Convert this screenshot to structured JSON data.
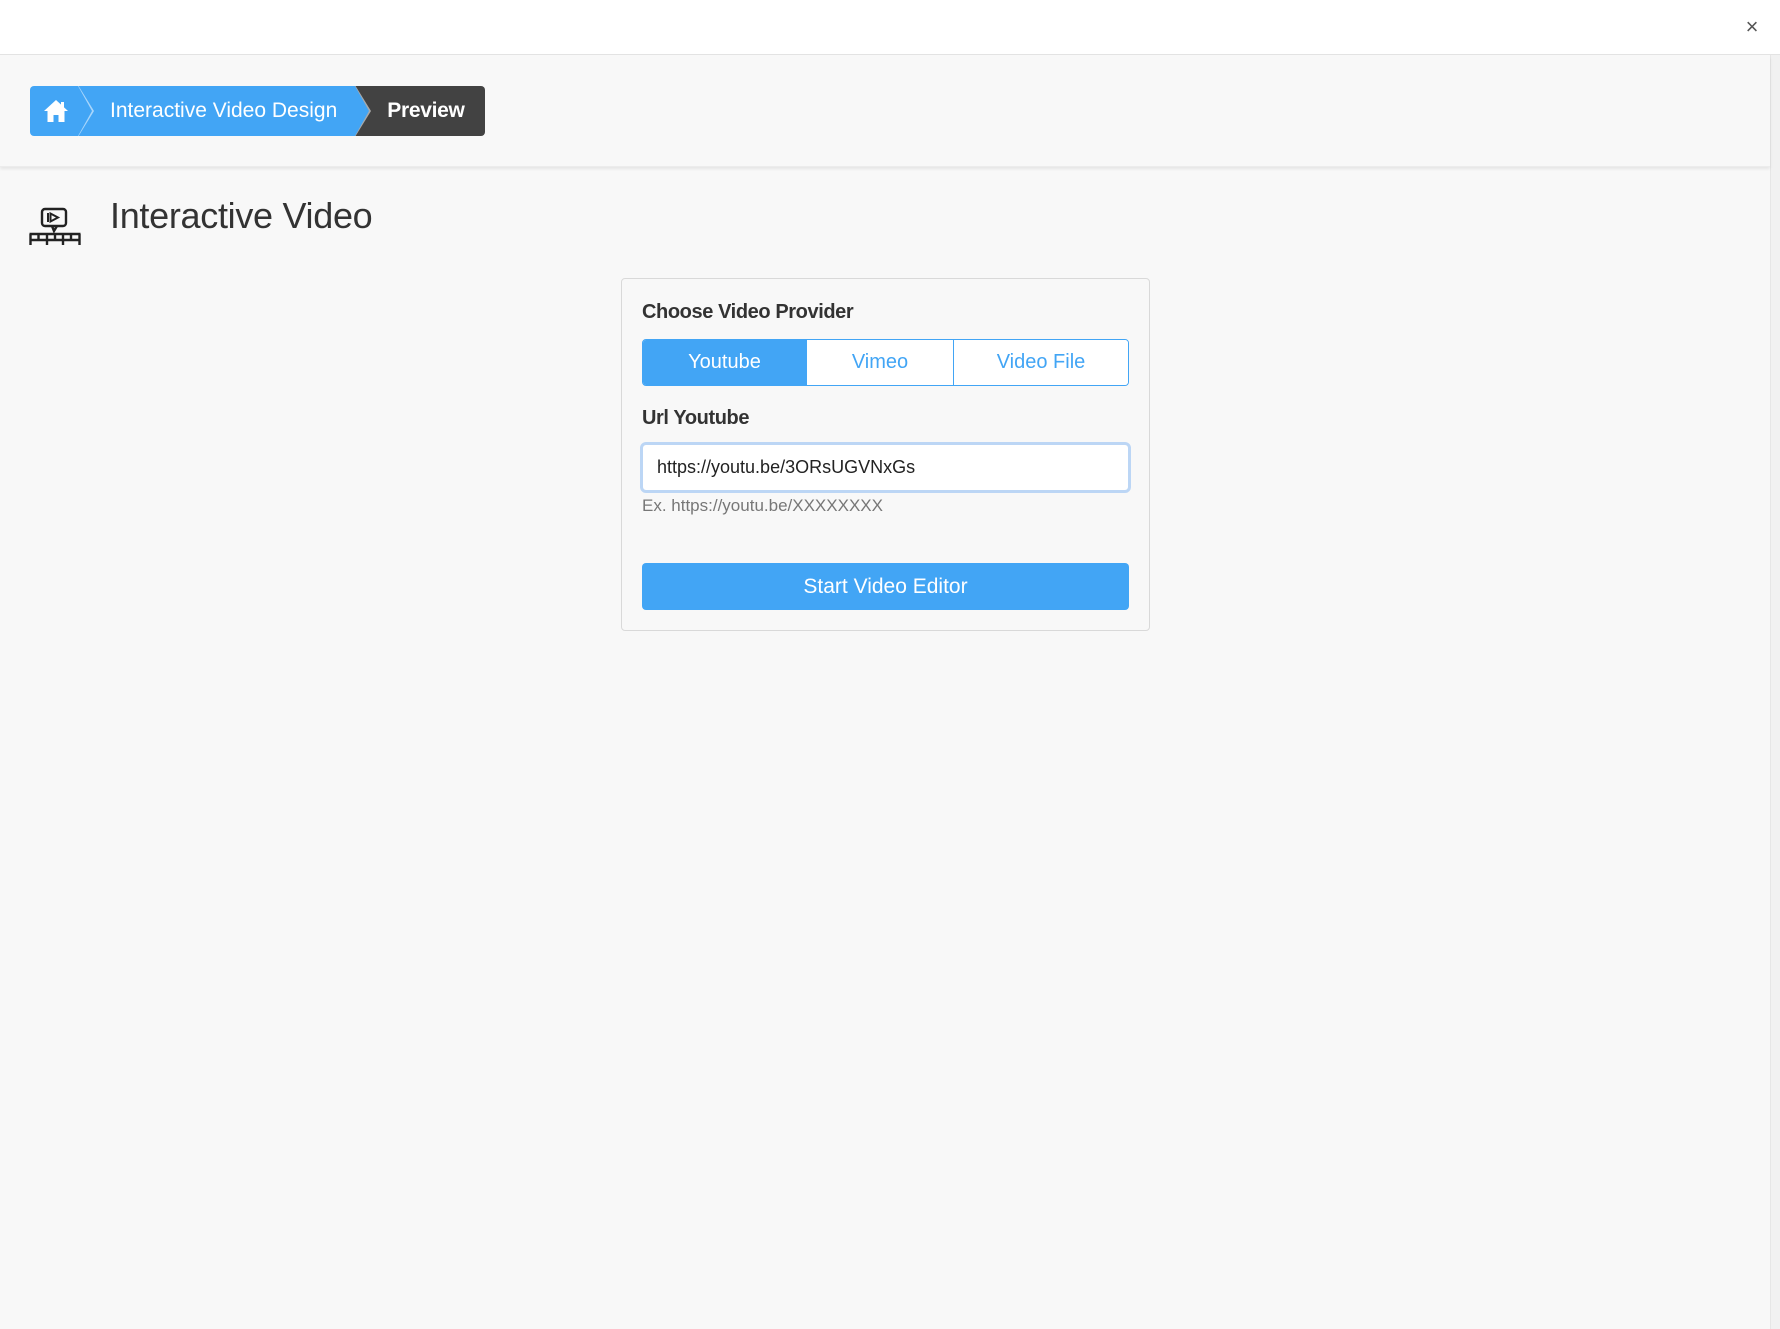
{
  "modal": {
    "close_label": "×"
  },
  "breadcrumb": {
    "home_icon": "home-icon",
    "items": [
      "Interactive Video Design",
      "Preview"
    ]
  },
  "page": {
    "title": "Interactive Video",
    "icon": "interactive-video-icon"
  },
  "form": {
    "provider_label": "Choose Video Provider",
    "providers": [
      "Youtube",
      "Vimeo",
      "Video File"
    ],
    "selected_provider": "Youtube",
    "url_label": "Url Youtube",
    "url_value": "https://youtu.be/3ORsUGVNxGs",
    "url_help": "Ex. https://youtu.be/XXXXXXXX",
    "start_label": "Start Video Editor"
  },
  "colors": {
    "accent": "#42a5f5",
    "dark_crumb": "#424242",
    "background": "#f8f8f8"
  }
}
